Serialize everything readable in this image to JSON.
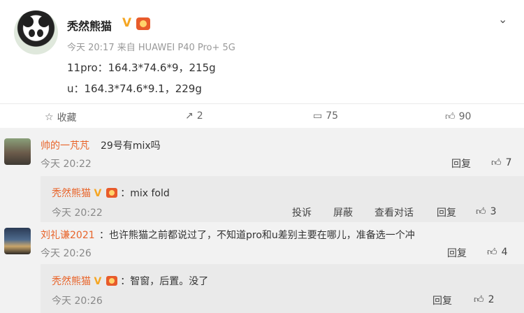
{
  "post": {
    "username": "秃然熊猫",
    "meta": "今天 20:17 来自 HUAWEI P40 Pro+ 5G",
    "line1": "11pro：164.3*74.6*9，215g",
    "line2": "u：164.3*74.6*9.1，229g",
    "actions": {
      "favorite_label": "收藏",
      "repost_count": "2",
      "comment_count": "75",
      "like_count": "90"
    }
  },
  "comments": [
    {
      "name": "帅的一芃芃",
      "text": "29号有mix吗",
      "time": "今天 20:22",
      "reply_label": "回复",
      "likes": "7",
      "replies": [
        {
          "name": "秃然熊猫",
          "text": "：mix fold",
          "time": "今天 20:22",
          "report_label": "投诉",
          "block_label": "屏蔽",
          "view_label": "查看对话",
          "reply_label": "回复",
          "likes": "3"
        }
      ]
    },
    {
      "name": "刘礼谦2021",
      "text": "：也许熊猫之前都说过了，不知道pro和u差别主要在哪儿，准备选一个冲",
      "time": "今天 20:26",
      "reply_label": "回复",
      "likes": "4",
      "replies": [
        {
          "name": "秃然熊猫",
          "text": "：智窗，后置。没了",
          "time": "今天 20:26",
          "reply_label": "回复",
          "likes": "2"
        }
      ]
    }
  ]
}
